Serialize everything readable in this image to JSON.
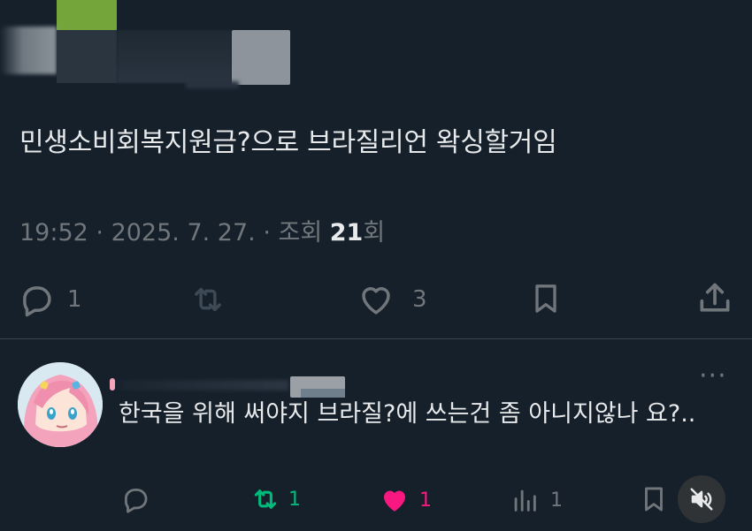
{
  "tweet": {
    "text": "민생소비회복지원금?으로 브라질리언 왁싱할거임",
    "time": "19:52",
    "sep1": " · ",
    "date": "2025. 7. 27.",
    "sep2": " · ",
    "views_label": "조회 ",
    "views_count": "21",
    "views_suffix": "회"
  },
  "actions": {
    "replies": "1",
    "retweets": "",
    "likes": "3"
  },
  "reply": {
    "text": "한국을 위해 써야지 브라질?에 쓰는건 좀 아니지않나 요?..",
    "more": "···",
    "replies": "",
    "retweets": "1",
    "likes": "1",
    "views": "1"
  },
  "colors": {
    "background": "#15202b",
    "text": "#e7e9ea",
    "muted": "#71767b",
    "retweet_active": "#00ba7c",
    "like_active": "#f91880"
  },
  "icons": [
    "reply-icon",
    "retweet-icon",
    "like-icon",
    "bookmark-icon",
    "share-icon",
    "more-icon",
    "views-icon",
    "mute-icon"
  ]
}
